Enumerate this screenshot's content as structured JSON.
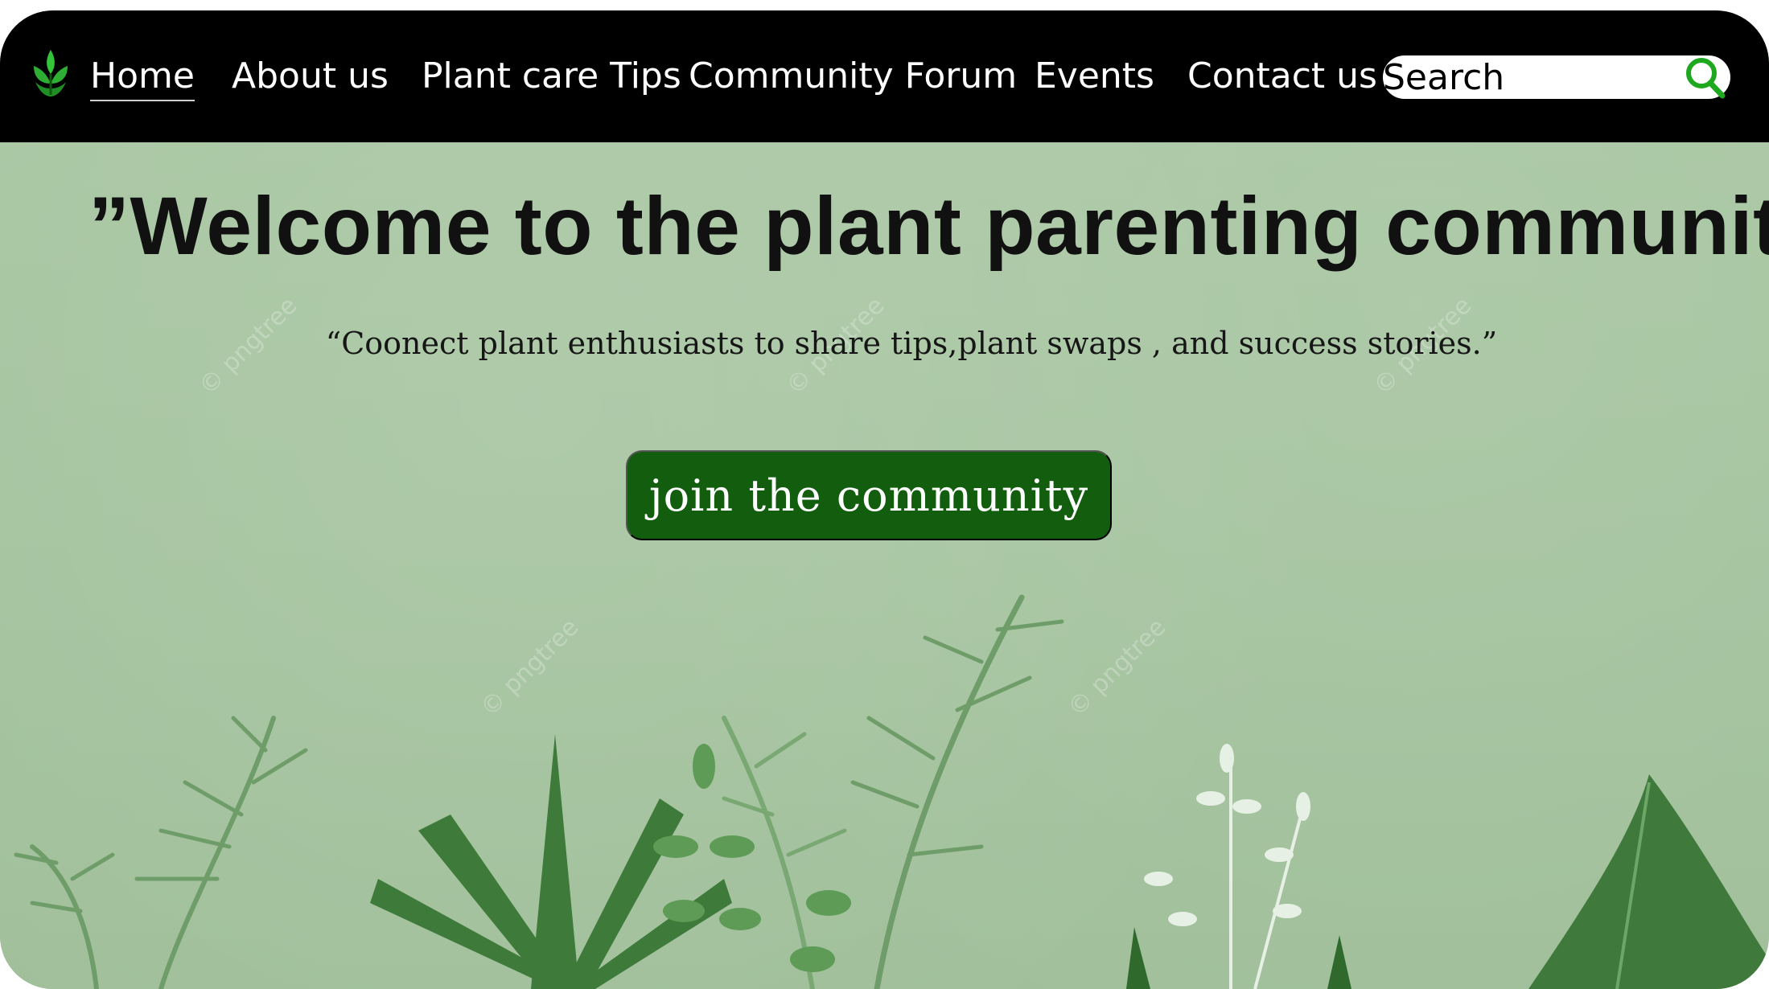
{
  "nav": {
    "items": [
      {
        "label": "Home",
        "active": true
      },
      {
        "label": "About us"
      },
      {
        "label": "Plant care Tips"
      },
      {
        "label": "Community Forum"
      },
      {
        "label": "Events"
      },
      {
        "label": "Contact us"
      }
    ],
    "search": {
      "placeholder": "Search"
    }
  },
  "hero": {
    "title": "”Welcome to the plant parenting community!’",
    "subtitle": "“Coonect plant enthusiasts to share tips,plant swaps , and success stories.”",
    "cta_label": "join the community"
  },
  "colors": {
    "navbar": "#000000",
    "hero_background": "#a7c6a1",
    "cta_background": "#125e0e",
    "search_icon": "#1ea81e"
  },
  "icons": {
    "logo": "plant-logo-icon",
    "search": "search-icon"
  }
}
